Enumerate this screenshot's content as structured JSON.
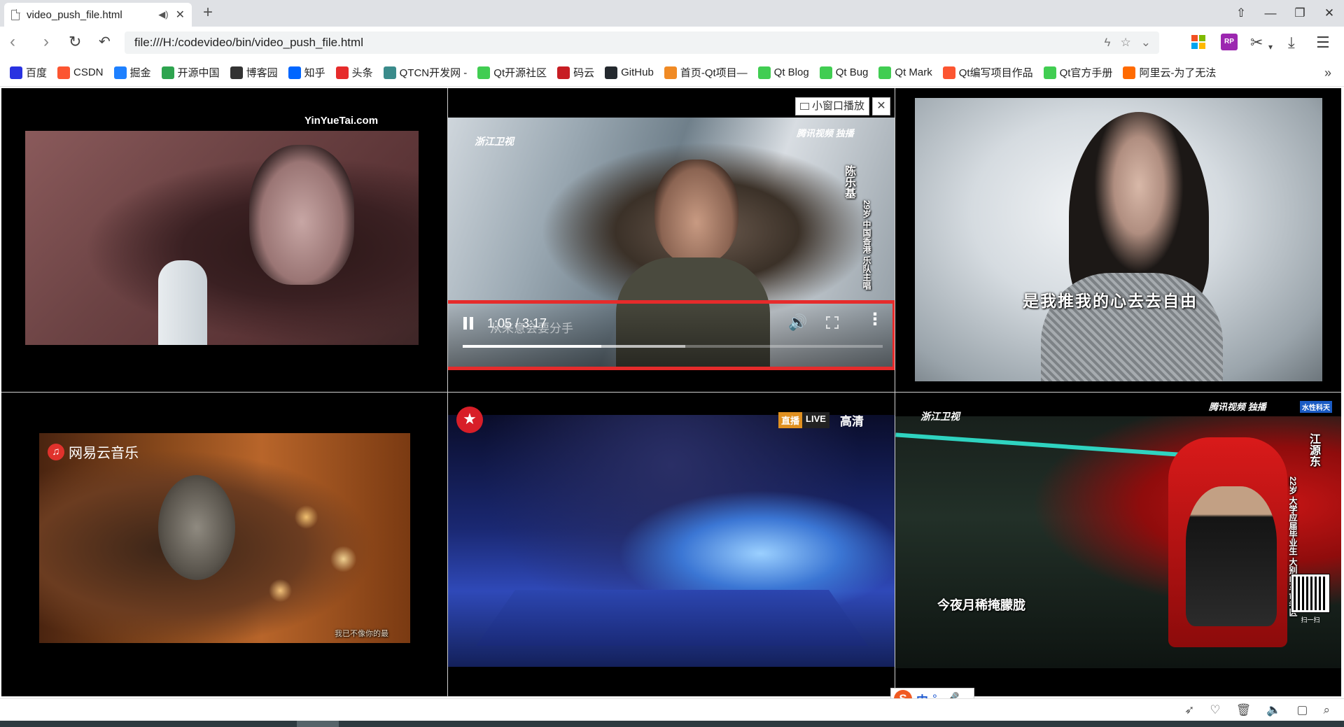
{
  "browser": {
    "tab_title": "video_push_file.html",
    "new_tab": "+",
    "window_controls": [
      "⇧",
      "—",
      "❐",
      "✕"
    ],
    "url": "file:///H:/codevideo/bin/video_push_file.html"
  },
  "bookmarks": [
    {
      "label": "百度",
      "icon": "baidu-icon",
      "color": "#2932e1"
    },
    {
      "label": "CSDN",
      "icon": "csdn-icon",
      "color": "#fc5531"
    },
    {
      "label": "掘金",
      "icon": "juejin-icon",
      "color": "#1e80ff"
    },
    {
      "label": "开源中国",
      "icon": "oschina-icon",
      "color": "#2ea44f"
    },
    {
      "label": "博客园",
      "icon": "cnblogs-icon",
      "color": "#333333"
    },
    {
      "label": "知乎",
      "icon": "zhihu-icon",
      "color": "#0066ff"
    },
    {
      "label": "头条",
      "icon": "toutiao-icon",
      "color": "#e62b2b"
    },
    {
      "label": "QTCN开发网 -",
      "icon": "qtcn-icon",
      "color": "#3a8b8b"
    },
    {
      "label": "Qt开源社区",
      "icon": "qt-community-icon",
      "color": "#41cd52"
    },
    {
      "label": "码云",
      "icon": "gitee-icon",
      "color": "#c71d23"
    },
    {
      "label": "GitHub",
      "icon": "github-icon",
      "color": "#24292e"
    },
    {
      "label": "首页-Qt项目—",
      "icon": "qt-project-icon",
      "color": "#f08a24"
    },
    {
      "label": "Qt Blog",
      "icon": "qt-blog-icon",
      "color": "#41cd52"
    },
    {
      "label": "Qt Bug",
      "icon": "qt-bug-icon",
      "color": "#41cd52"
    },
    {
      "label": "Qt Mark",
      "icon": "qt-mark-icon",
      "color": "#41cd52"
    },
    {
      "label": "Qt编写项目作品",
      "icon": "qt-works-icon",
      "color": "#fc5531"
    },
    {
      "label": "Qt官方手册",
      "icon": "qt-manual-icon",
      "color": "#41cd52"
    },
    {
      "label": "阿里云-为了无法",
      "icon": "aliyun-icon",
      "color": "#ff6a00"
    }
  ],
  "bookmarks_more": "»",
  "videos": {
    "v1": {
      "watermark": "YinYueTai.com"
    },
    "v2": {
      "channel": "浙江卫视",
      "sponsor": "腾讯视频 独播",
      "caption_vertical": "陈乐基",
      "caption_side": "29岁 中国香港 乐队主唱",
      "pip_label": "小窗口播放",
      "pip_close": "✕",
      "player": {
        "time": "1:05 / 3:17",
        "ghost_subtitle": "从来意会要分手",
        "progress": 0.33,
        "buffered": 0.53
      }
    },
    "v3": {
      "subtitle": "是我推我的心去去自由"
    },
    "v4": {
      "logo": "网易云音乐",
      "caption": "我已不像你的最"
    },
    "v5": {
      "live_badge": "直播",
      "live_text": "LIVE",
      "quality": "高清"
    },
    "v6": {
      "channel": "浙江卫视",
      "sponsor": "腾讯视频 独播",
      "tag": "水性科天",
      "caption_vertical": "江源东",
      "caption_side": "22岁 大学应届毕业生 大别山革命老区",
      "subtitle": "今夜月稀掩朦胧",
      "qr_caption": "扫一扫"
    }
  },
  "ime": {
    "logo": "S",
    "lang": "中",
    "punct": "°,",
    "mic": "🎤"
  }
}
